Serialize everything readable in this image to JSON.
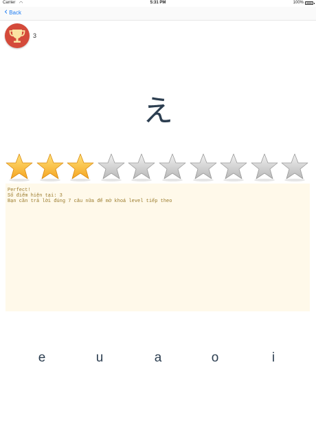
{
  "status_bar": {
    "carrier": "Carrier",
    "time": "5:31 PM",
    "battery": "100%"
  },
  "nav": {
    "back_label": "Back"
  },
  "score": {
    "value": "3",
    "icon": "trophy-icon",
    "badge_color": "#d44a3a"
  },
  "question": {
    "character": "え"
  },
  "rating": {
    "filled": 3,
    "total": 10
  },
  "message": {
    "line1": "Perfect!",
    "line2": "Số điểm hiện tại: 3",
    "line3": "Bạn cần trả lời đúng 7 câu nữa để mở khoá level tiếp theo"
  },
  "answers": [
    "e",
    "u",
    "a",
    "o",
    "i"
  ],
  "colors": {
    "accent": "#1e7cf2",
    "star_gold": "#f5a623",
    "star_gray": "#b8b8b8"
  }
}
